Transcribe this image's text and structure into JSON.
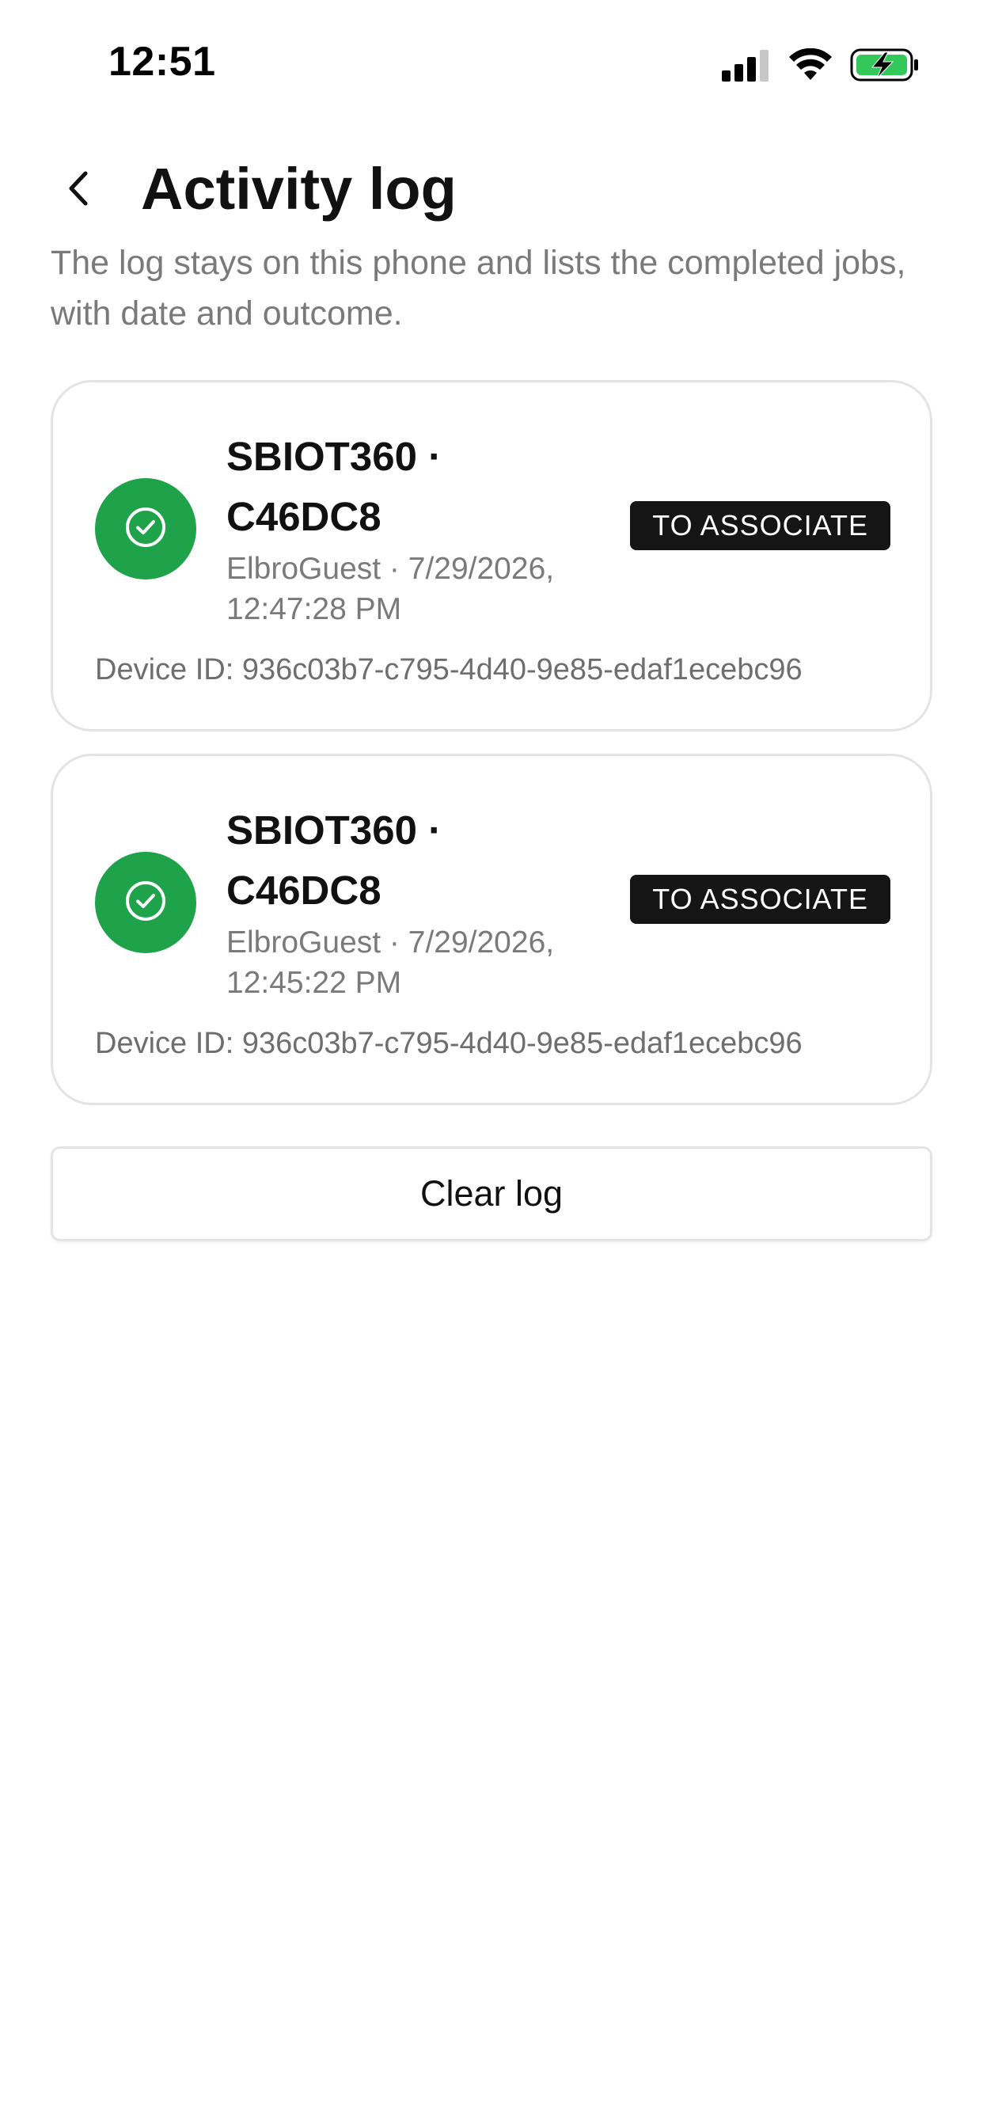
{
  "status_bar": {
    "time": "12:51",
    "icons": [
      "cellular-signal-icon",
      "wifi-icon",
      "battery-charging-icon"
    ],
    "battery_color": "#34c759"
  },
  "header": {
    "back_icon": "chevron-left-icon",
    "title": "Activity log",
    "subtitle": "The log stays on this phone and lists the completed jobs, with date and outcome."
  },
  "log_entries": [
    {
      "icon": "check-circle-icon",
      "icon_color": "#1fa34a",
      "title": "SBIOT360 · C46DC8",
      "meta": "ElbroGuest · 7/29/2026, 12:47:28 PM",
      "badge": "TO ASSOCIATE",
      "device_id": "Device ID: 936c03b7-c795-4d40-9e85-edaf1ecebc96"
    },
    {
      "icon": "check-circle-icon",
      "icon_color": "#1fa34a",
      "title": "SBIOT360 · C46DC8",
      "meta": "ElbroGuest · 7/29/2026, 12:45:22 PM",
      "badge": "TO ASSOCIATE",
      "device_id": "Device ID: 936c03b7-c795-4d40-9e85-edaf1ecebc96"
    }
  ],
  "actions": {
    "clear_label": "Clear log"
  }
}
